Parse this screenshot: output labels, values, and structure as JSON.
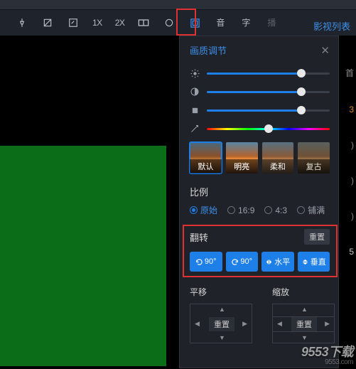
{
  "toolbar": {
    "items": {
      "pin": "📌",
      "crop": "✂",
      "crop_square": "▢",
      "speed_1x": "1X",
      "speed_2x": "2X",
      "window": "▭",
      "loop": "◯",
      "picture": "画",
      "audio": "音",
      "subtitle": "字",
      "play": "播"
    },
    "video_list": "影视列表"
  },
  "panel": {
    "title": "画质调节",
    "sliders": {
      "brightness": {
        "icon": "brightness",
        "percent": 77
      },
      "contrast": {
        "icon": "contrast",
        "percent": 77
      },
      "saturation": {
        "icon": "saturation",
        "percent": 77
      },
      "hue": {
        "icon": "hue",
        "percent": 50
      }
    },
    "presets": [
      {
        "key": "default",
        "label": "默认",
        "active": true
      },
      {
        "key": "bright",
        "label": "明亮",
        "active": false
      },
      {
        "key": "soft",
        "label": "柔和",
        "active": false
      },
      {
        "key": "retro",
        "label": "复古",
        "active": false
      }
    ],
    "ratio": {
      "label": "比例",
      "options": [
        {
          "label": "原始",
          "active": true
        },
        {
          "label": "16:9",
          "active": false
        },
        {
          "label": "4:3",
          "active": false
        },
        {
          "label": "铺满",
          "active": false
        }
      ]
    },
    "flip": {
      "label": "翻转",
      "reset": "重置",
      "buttons": [
        {
          "key": "ccw90",
          "label": "90°"
        },
        {
          "key": "cw90",
          "label": "90°"
        },
        {
          "key": "h",
          "label": "水平"
        },
        {
          "key": "v",
          "label": "垂直"
        }
      ]
    },
    "pan": {
      "label": "平移",
      "reset": "重置"
    },
    "zoom": {
      "label": "缩放",
      "reset": "重置"
    }
  },
  "side_cut": {
    "a": "首",
    "b": "3",
    "c": ")",
    "d": ")",
    "e": ")",
    "f": "5"
  },
  "watermark": {
    "main": "9553下载",
    "sub": "9553.com"
  }
}
